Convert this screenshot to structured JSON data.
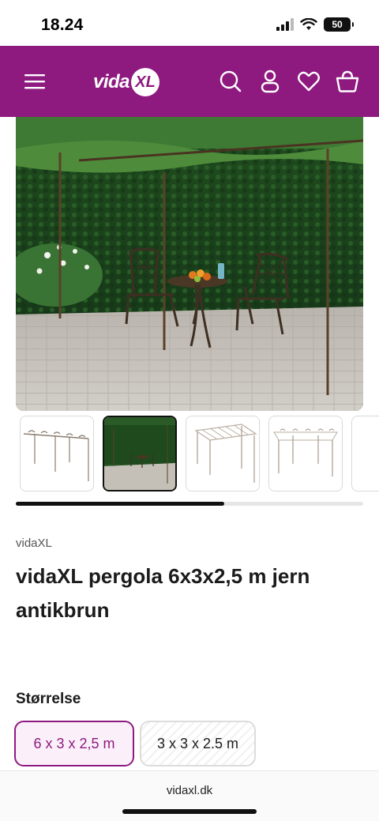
{
  "status_bar": {
    "time": "18.24",
    "battery": "50"
  },
  "header": {
    "logo_text": "vida",
    "logo_badge": "XL",
    "icons": [
      "menu-icon",
      "search-icon",
      "account-icon",
      "heart-icon",
      "basket-icon"
    ],
    "background": "#8e1a80"
  },
  "gallery": {
    "thumbnail_count": 5,
    "selected_index": 1,
    "scroll_progress": 0.6
  },
  "product": {
    "brand": "vidaXL",
    "title": "vidaXL pergola 6x3x2,5 m jern antikbrun"
  },
  "size": {
    "label": "Størrelse",
    "options": [
      {
        "label": "6 x 3 x 2,5 m",
        "selected": true
      },
      {
        "label": "3 x 3 x 2.5 m",
        "selected": false
      }
    ]
  },
  "browser": {
    "url": "vidaxl.dk"
  },
  "colors": {
    "accent": "#8e1a80",
    "text": "#1b1b1b"
  }
}
